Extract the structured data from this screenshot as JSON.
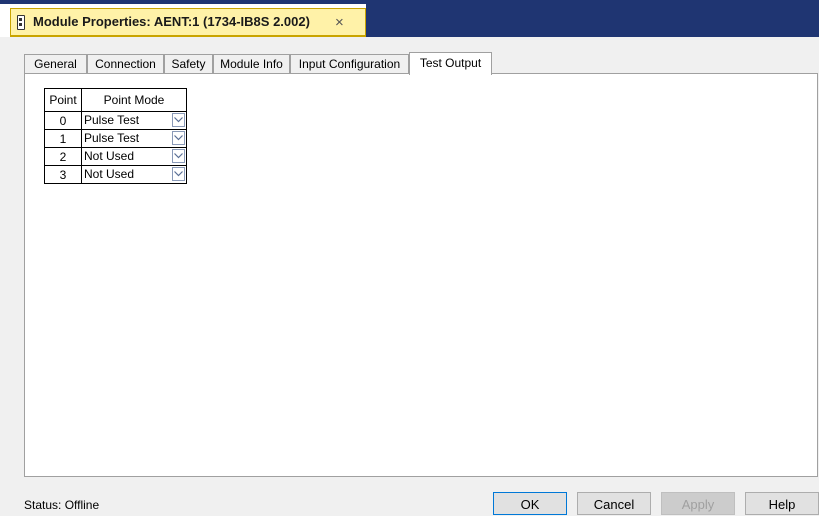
{
  "window": {
    "title": "Module Properties: AENT:1 (1734-IB8S 2.002)",
    "close_glyph": "×",
    "icon": "module-icon"
  },
  "tabs": [
    {
      "label": "General",
      "active": false
    },
    {
      "label": "Connection",
      "active": false
    },
    {
      "label": "Safety",
      "active": false
    },
    {
      "label": "Module Info",
      "active": false
    },
    {
      "label": "Input Configuration",
      "active": false
    },
    {
      "label": "Test Output",
      "active": true
    }
  ],
  "grid": {
    "headers": {
      "point": "Point",
      "mode": "Point Mode"
    },
    "rows": [
      {
        "point": "0",
        "mode": "Pulse Test"
      },
      {
        "point": "1",
        "mode": "Pulse Test"
      },
      {
        "point": "2",
        "mode": "Not Used"
      },
      {
        "point": "3",
        "mode": "Not Used"
      }
    ]
  },
  "status": {
    "text": "Status:  Offline"
  },
  "buttons": {
    "ok": "OK",
    "cancel": "Cancel",
    "apply": "Apply",
    "help": "Help"
  },
  "colors": {
    "titlebar": "#1f3572",
    "doc_tab": "#fff2a8",
    "doc_tab_border": "#c9a400",
    "default_button_border": "#0078d7"
  }
}
